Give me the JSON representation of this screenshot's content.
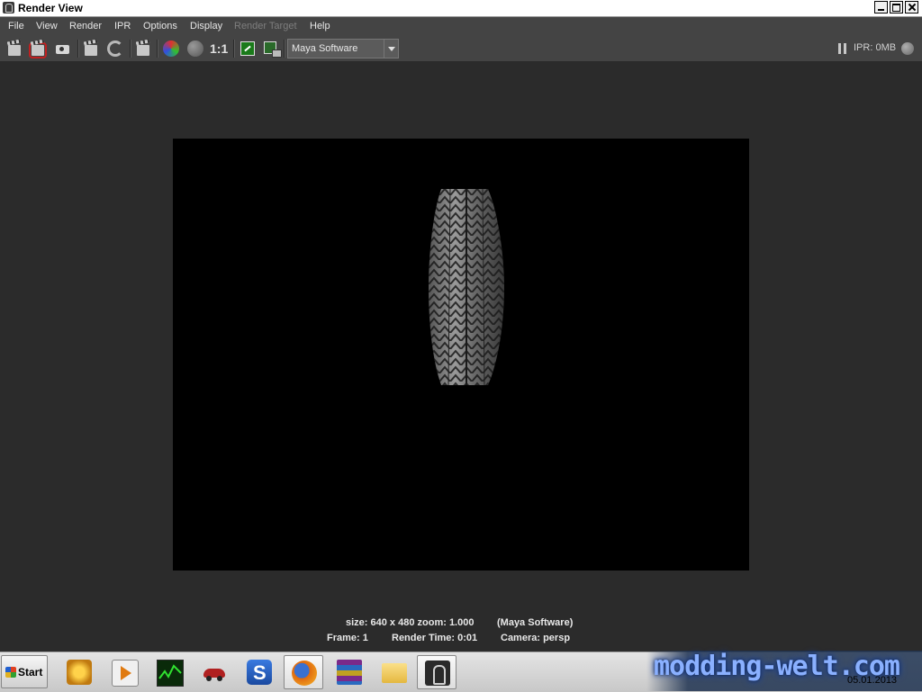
{
  "window": {
    "title": "Render View"
  },
  "menu": {
    "items": [
      {
        "label": "File",
        "enabled": true
      },
      {
        "label": "View",
        "enabled": true
      },
      {
        "label": "Render",
        "enabled": true
      },
      {
        "label": "IPR",
        "enabled": true
      },
      {
        "label": "Options",
        "enabled": true
      },
      {
        "label": "Display",
        "enabled": true
      },
      {
        "label": "Render Target",
        "enabled": false
      },
      {
        "label": "Help",
        "enabled": true
      }
    ]
  },
  "toolbar": {
    "ratio_label": "1:1",
    "renderer_dropdown": {
      "value": "Maya Software"
    },
    "ipr_memory": "IPR: 0MB"
  },
  "status": {
    "size_zoom": "size: 640 x 480 zoom: 1.000",
    "renderer": "(Maya Software)",
    "frame": "Frame: 1",
    "render_time": "Render Time: 0:01",
    "camera": "Camera: persp"
  },
  "taskbar": {
    "start_label": "Start",
    "watermark": "modding-welt.com",
    "date": "05.01.2013"
  },
  "colors": {
    "ui_background": "#2b2b2b",
    "menubar": "#444444",
    "render_background": "#000000"
  }
}
